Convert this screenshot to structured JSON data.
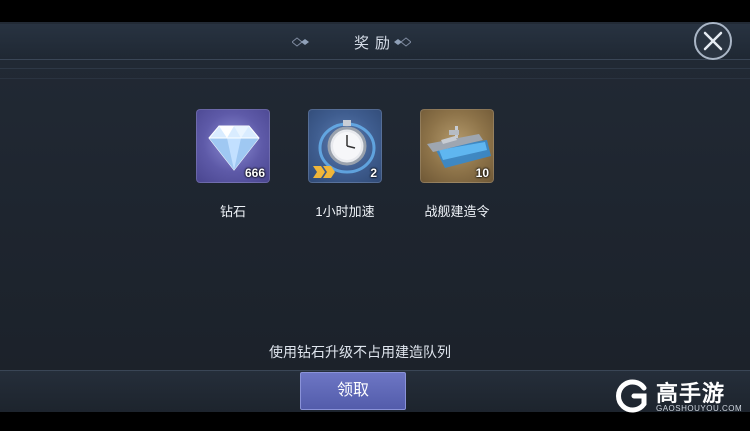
{
  "dialog": {
    "title": "奖励",
    "hint": "使用钻石升级不占用建造队列",
    "claim_label": "领取"
  },
  "rewards": [
    {
      "name": "钻石",
      "count": "666",
      "icon": "diamond-icon",
      "tile_color": "#5e5aa8"
    },
    {
      "name": "1小时加速",
      "count": "2",
      "icon": "stopwatch-icon",
      "tile_color": "#3f5d8f"
    },
    {
      "name": "战舰建造令",
      "count": "10",
      "icon": "battleship-icon",
      "tile_color": "#8d7349"
    }
  ],
  "watermark": {
    "brand": "高手游",
    "domain": "GAOSHOUYOU.COM"
  },
  "colors": {
    "panel_bg": "#1e252f",
    "button": "#5a63b3",
    "text": "#e8ecf2"
  }
}
